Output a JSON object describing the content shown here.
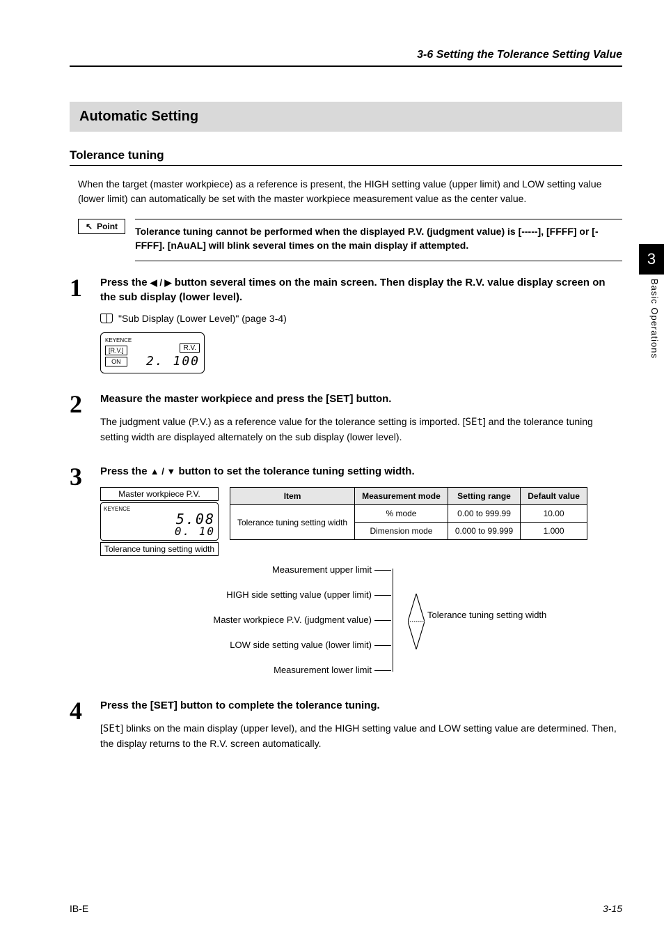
{
  "header": {
    "section": "3-6  Setting the Tolerance Setting Value"
  },
  "sideTab": {
    "chapter": "3",
    "label": "Basic Operations"
  },
  "section": {
    "title": "Automatic Setting",
    "sub": "Tolerance tuning",
    "intro": "When the target (master workpiece) as a reference is present, the HIGH setting value (upper limit) and LOW setting value (lower limit) can automatically be set with the master workpiece measurement value as the center value."
  },
  "point": {
    "label": "Point",
    "text": "Tolerance tuning cannot be performed when the displayed P.V. (judgment value) is [-----], [FFFF] or [-FFFF]. [nAuAL] will blink several times on the main display if attempted."
  },
  "steps": {
    "s1": {
      "num": "1",
      "title_prefix": "Press the ",
      "title_mid": " button several times on the main screen. Then display the R.V. value display screen on the sub display (lower level).",
      "ref": "\"Sub Display (Lower Level)\" (page 3-4)",
      "device": {
        "rv_label": "[R.V.]",
        "on": "ON",
        "rv_box": "R.V.",
        "seg": "2. 100",
        "brand": "KEYENCE"
      }
    },
    "s2": {
      "num": "2",
      "title": "Measure the master workpiece and press the [SET] button.",
      "desc": "The judgment value (P.V.) as a reference value for the tolerance setting is imported. [SEt] and the tolerance tuning setting width are displayed alternately on the sub display (lower level)."
    },
    "s3": {
      "num": "3",
      "title_prefix": "Press the ",
      "title_suffix": " button to set the tolerance tuning setting width.",
      "master_top": "Master workpiece P.V.",
      "master_val1": "5.08",
      "master_val2": "0. 10",
      "master_bottom": "Tolerance tuning setting width",
      "brand": "KEYENCE",
      "table": {
        "headers": [
          "Item",
          "Measurement mode",
          "Setting range",
          "Default value"
        ],
        "item": "Tolerance tuning setting width",
        "r1": {
          "mode": "% mode",
          "range": "0.00 to 999.99",
          "def": "10.00"
        },
        "r2": {
          "mode": "Dimension mode",
          "range": "0.000 to 99.999",
          "def": "1.000"
        }
      },
      "diagram": {
        "l1": "Measurement upper limit",
        "l2": "HIGH side setting value (upper limit)",
        "l3": "Master workpiece P.V. (judgment value)",
        "l4": "LOW side setting value (lower limit)",
        "l5": "Measurement lower limit",
        "tol": "Tolerance tuning setting width"
      }
    },
    "s4": {
      "num": "4",
      "title": "Press the [SET] button to complete the tolerance tuning.",
      "desc": "[SEt] blinks on the main display (upper level), and the HIGH setting value and LOW setting value are determined. Then, the display returns to the R.V. screen automatically."
    }
  },
  "footer": {
    "left": "IB-E",
    "right": "3-15"
  }
}
